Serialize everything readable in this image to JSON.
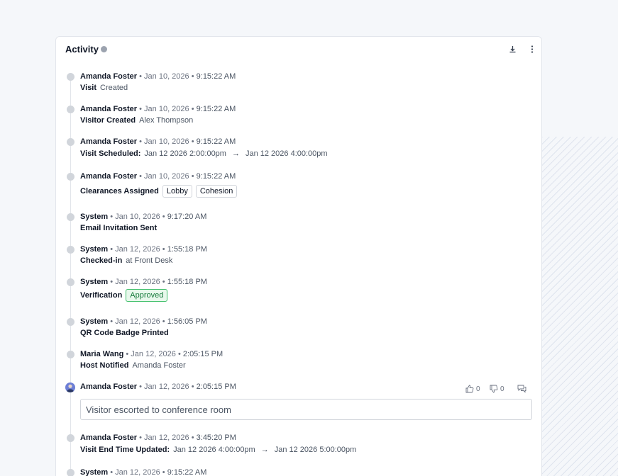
{
  "activity": {
    "title": "Activity",
    "icons": {
      "info": "info-icon",
      "download": "download-icon",
      "more": "more-vertical-icon"
    }
  },
  "entries": [
    {
      "author": "Amanda Foster",
      "date": "Jan 10, 2026",
      "time": "9:15:22 AM",
      "action": "Visit",
      "detail": "Created"
    },
    {
      "author": "Amanda Foster",
      "date": "Jan 10, 2026",
      "time": "9:15:22 AM",
      "action": "Visitor Created",
      "detail": "Alex Thompson"
    },
    {
      "author": "Amanda Foster",
      "date": "Jan 10, 2026",
      "time": "9:15:22 AM",
      "action": "Visit Scheduled:",
      "from": "Jan 12 2026 2:00:00pm",
      "to": "Jan 12 2026 4:00:00pm"
    },
    {
      "author": "Amanda Foster",
      "date": "Jan 10, 2026",
      "time": "9:15:22 AM",
      "action": "Clearances Assigned",
      "chips": [
        "Lobby",
        "Cohesion"
      ]
    },
    {
      "author": "System",
      "date": "Jan 10, 2026",
      "time": "9:17:20 AM",
      "action": "Email Invitation Sent"
    },
    {
      "author": "System",
      "date": "Jan 12, 2026",
      "time": "1:55:18 PM",
      "action": "Checked-in",
      "detail": "at Front Desk"
    },
    {
      "author": "System",
      "date": "Jan 12, 2026",
      "time": "1:55:18 PM",
      "action": "Verification",
      "status": "Approved"
    },
    {
      "author": "System",
      "date": "Jan 12, 2026",
      "time": "1:56:05 PM",
      "action": "QR Code Badge Printed"
    },
    {
      "author": "Maria Wang",
      "date": "Jan 12, 2026",
      "time": "2:05:15 PM",
      "action": "Host Notified",
      "detail": "Amanda Foster"
    },
    {
      "author": "Amanda Foster",
      "date": "Jan 12, 2026",
      "time": "2:05:15 PM",
      "comment": "Visitor escorted to conference room",
      "likes": "0",
      "dislikes": "0"
    },
    {
      "author": "Amanda Foster",
      "date": "Jan 12, 2026",
      "time": "3:45:20 PM",
      "action": "Visit End Time Updated:",
      "from": "Jan 12 2026 4:00:00pm",
      "to": "Jan 12 2026 5:00:00pm"
    },
    {
      "author": "System",
      "date": "Jan 12, 2026",
      "time": "9:15:22 AM"
    }
  ],
  "colors": {
    "success": "#157a3a",
    "success_bg": "#e8f8ec",
    "dot": "#d1d5db"
  }
}
